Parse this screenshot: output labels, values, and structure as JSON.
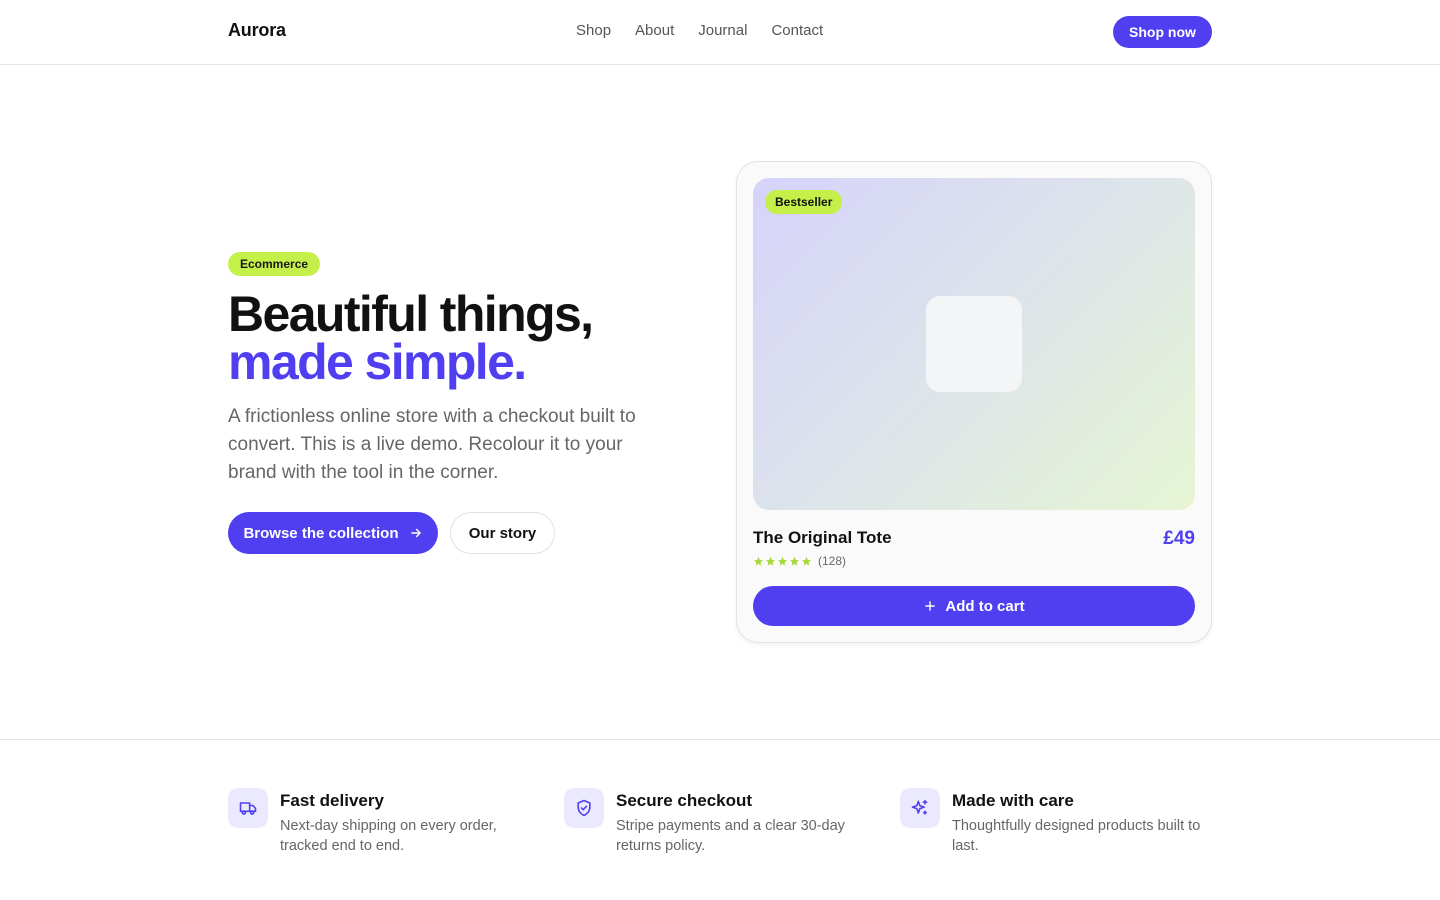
{
  "header": {
    "brand": "Aurora",
    "nav": [
      "Shop",
      "About",
      "Journal",
      "Contact"
    ],
    "cta": "Shop now"
  },
  "hero": {
    "tag": "Ecommerce",
    "title_line1": "Beautiful things,",
    "title_line2": "made simple.",
    "lead": "A frictionless online store with a checkout built to convert. This is a live demo. Recolour it to your brand with the tool in the corner.",
    "primary_cta": "Browse the collection",
    "secondary_cta": "Our story"
  },
  "product": {
    "badge": "Bestseller",
    "name": "The Original Tote",
    "price": "£49",
    "rating_stars": 5,
    "review_count": "(128)",
    "add_to_cart": "Add to cart"
  },
  "features": [
    {
      "icon": "truck-icon",
      "title": "Fast delivery",
      "desc": "Next-day shipping on every order, tracked end to end."
    },
    {
      "icon": "shield-check-icon",
      "title": "Secure checkout",
      "desc": "Stripe payments and a clear 30-day returns policy."
    },
    {
      "icon": "sparkles-icon",
      "title": "Made with care",
      "desc": "Thoughtfully designed products built to last."
    }
  ],
  "colors": {
    "accent": "#4f3ff0",
    "highlight": "#c4f049",
    "star": "#a8d93c",
    "icon_bg": "#ebe9fd"
  }
}
